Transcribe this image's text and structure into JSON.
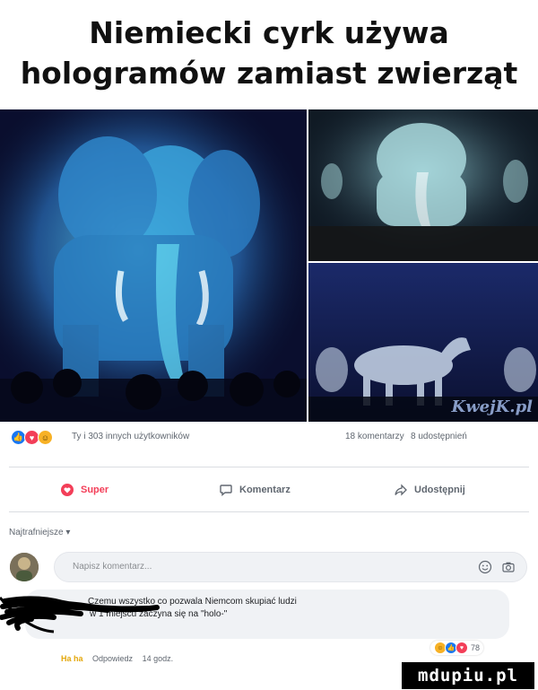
{
  "headline": {
    "line1": "Niemiecki cyrk używa",
    "line2": "hologramów zamiast zwierząt"
  },
  "photos": {
    "watermark": "KwejK.pl"
  },
  "post_stats": {
    "reactions_text": "Ty i 303 innych użytkowników",
    "comments": "18 komentarzy",
    "shares": "8 udostępnień"
  },
  "actions": {
    "super": "Super",
    "comment": "Komentarz",
    "share": "Udostępnij"
  },
  "sort": {
    "label": "Najtrafniejsze ▾"
  },
  "comment_input": {
    "placeholder": "Napisz komentarz..."
  },
  "comment": {
    "text_line1": "Czemu wszystko co pozwala Niemcom skupiać ludzi",
    "text_line2": "w 1 miejscu zaczyna się na \"holo-\"",
    "reaction_count": "78",
    "action_haha": "Ha ha",
    "action_reply": "Odpowiedz",
    "time": "14 godz."
  },
  "site_watermark": "mdupiu.pl",
  "colors": {
    "like_blue": "#1877f2",
    "love_red": "#f33e58",
    "haha_yellow": "#f7b125",
    "hologram_cyan": "#4fc3e8"
  }
}
